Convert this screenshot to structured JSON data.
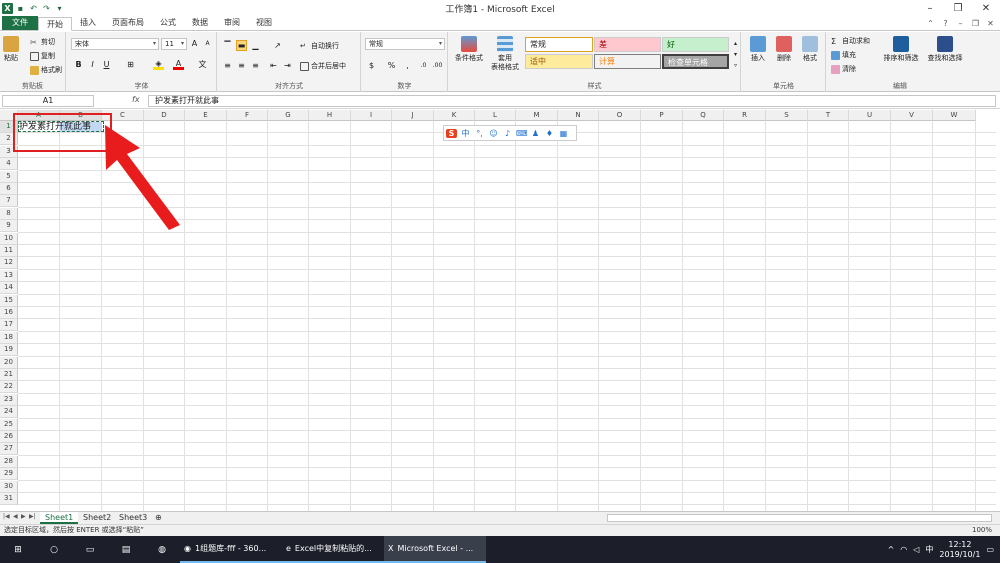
{
  "title": "工作簿1 - Microsoft Excel",
  "tabs": [
    "文件",
    "开始",
    "插入",
    "页面布局",
    "公式",
    "数据",
    "审阅",
    "视图"
  ],
  "clipboard": {
    "paste": "粘贴",
    "cut": "剪切",
    "copy": "复制",
    "painter": "格式刷",
    "label": "剪贴板"
  },
  "font": {
    "name": "宋体",
    "size": "11",
    "label": "字体"
  },
  "align": {
    "wrap": "自动换行",
    "merge": "合并后居中",
    "label": "对齐方式"
  },
  "number": {
    "format": "常规",
    "label": "数字"
  },
  "styles": {
    "cond": "条件格式",
    "table": "套用\n表格格式",
    "normal": "常规",
    "bad": "差",
    "good": "好",
    "neutral": "适中",
    "calc": "计算",
    "check": "检查单元格",
    "label": "样式"
  },
  "cells": {
    "insert": "插入",
    "delete": "删除",
    "format": "格式",
    "label": "单元格"
  },
  "editing": {
    "autosum": "自动求和",
    "fill": "填充",
    "clear": "清除",
    "sort": "排序和筛选",
    "find": "查找和选择",
    "label": "编辑"
  },
  "namebox": "A1",
  "formula": "护发素打开就此事",
  "columns": [
    "A",
    "B",
    "C",
    "D",
    "E",
    "F",
    "G",
    "H",
    "I",
    "J",
    "K",
    "L",
    "M",
    "N",
    "O",
    "P",
    "Q",
    "R",
    "S",
    "T",
    "U",
    "V",
    "W"
  ],
  "rows": [
    "1",
    "2",
    "3",
    "4",
    "5",
    "6",
    "7",
    "8",
    "9",
    "10",
    "11",
    "12",
    "13",
    "14",
    "15",
    "16",
    "17",
    "18",
    "19",
    "20",
    "21",
    "22",
    "23",
    "24",
    "25",
    "26",
    "27",
    "28",
    "29",
    "30",
    "31"
  ],
  "cell_a1": "护发素打开就此事",
  "sheets": [
    "Sheet1",
    "Sheet2",
    "Sheet3"
  ],
  "status": "选定目标区域，然后按 ENTER 或选择“粘贴”",
  "zoom": "100%",
  "taskbar": {
    "t1": "1组题库-fff - 360...",
    "t2": "Excel中复制粘贴的...",
    "t3": "Microsoft Excel - ..."
  },
  "tray": {
    "ime": "中",
    "time": "12:12",
    "date": "2019/10/1"
  }
}
